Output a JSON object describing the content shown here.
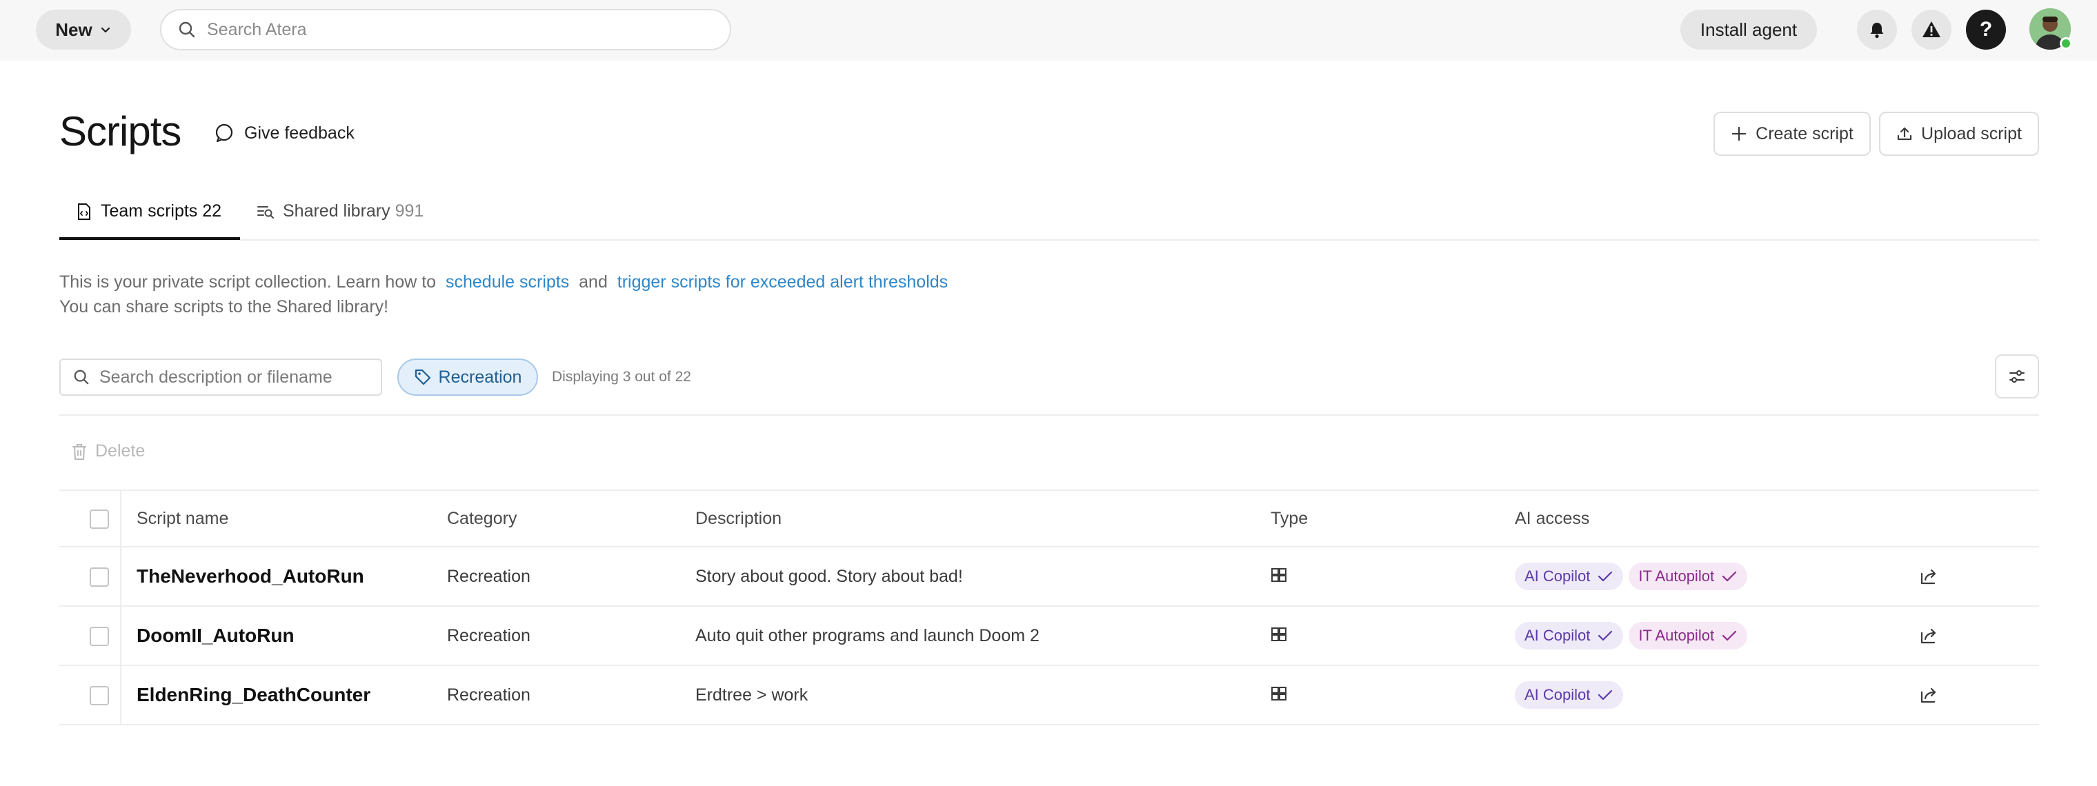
{
  "topbar": {
    "new_label": "New",
    "search_placeholder": "Search Atera",
    "install_label": "Install agent",
    "help_label": "?"
  },
  "header": {
    "title": "Scripts",
    "feedback_label": "Give feedback",
    "create_label": "Create script",
    "upload_label": "Upload script"
  },
  "tabs": [
    {
      "label": "Team scripts",
      "count": "22"
    },
    {
      "label": "Shared library",
      "count": "991"
    }
  ],
  "info": {
    "line1_prefix": "This is your private script collection. Learn how to",
    "link1": "schedule scripts",
    "and_word": "and",
    "link2": "trigger scripts for exceeded alert thresholds",
    "line2": "You can share scripts to the Shared library!"
  },
  "filter": {
    "search_placeholder": "Search description or filename",
    "chip_label": "Recreation",
    "displaying": "Displaying 3 out of 22"
  },
  "actions": {
    "delete_label": "Delete"
  },
  "table": {
    "columns": [
      "Script name",
      "Category",
      "Description",
      "Type",
      "AI access"
    ],
    "rows": [
      {
        "name": "TheNeverhood_AutoRun",
        "category": "Recreation",
        "description": "Story about good. Story about bad!",
        "type": "windows-icon",
        "ai": [
          "AI Copilot",
          "IT Autopilot"
        ]
      },
      {
        "name": "DoomII_AutoRun",
        "category": "Recreation",
        "description": "Auto quit other programs and launch Doom 2",
        "type": "windows-icon",
        "ai": [
          "AI Copilot",
          "IT Autopilot"
        ]
      },
      {
        "name": "EldenRing_DeathCounter",
        "category": "Recreation",
        "description": "Erdtree > work",
        "type": "windows-icon",
        "ai": [
          "AI Copilot"
        ]
      }
    ]
  },
  "colors": {
    "link": "#2e86c9",
    "chip_bg": "#e3effa",
    "copilot_bg": "#efeaf8",
    "autopilot_bg": "#f6e8f5",
    "online": "#3fbf48"
  }
}
